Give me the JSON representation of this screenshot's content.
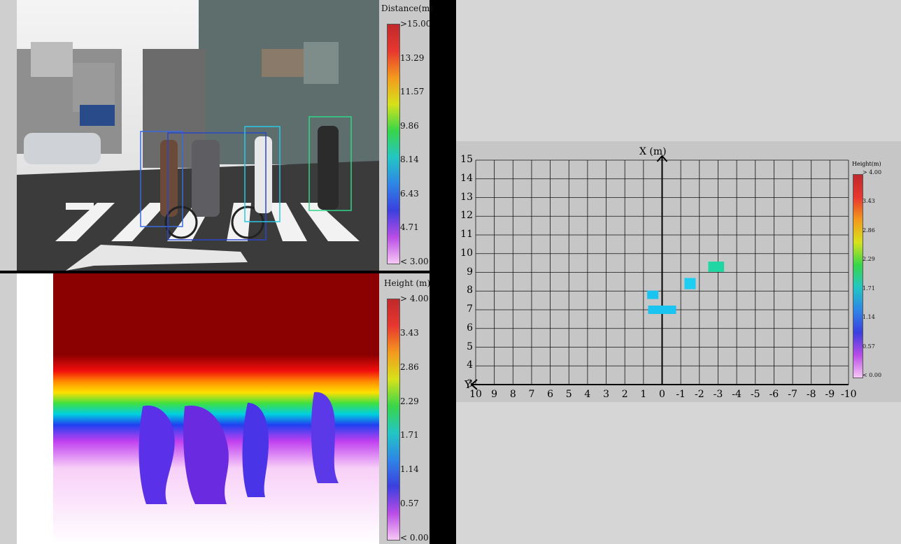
{
  "distance_colorbar": {
    "title": "Distance(m)",
    "ticks": [
      ">15.00",
      "13.29",
      "11.57",
      "9.86",
      "8.14",
      "6.43",
      "4.71",
      "< 3.00"
    ],
    "gradient": [
      "#c0292b",
      "#e8372f",
      "#f39a1d",
      "#d6e21a",
      "#38d64a",
      "#22c6c4",
      "#2e86e6",
      "#3b3fe0",
      "#b94ce6",
      "#f7c8f5"
    ]
  },
  "height_colorbar": {
    "title": "Height (m)",
    "ticks": [
      "> 4.00",
      "3.43",
      "2.86",
      "2.29",
      "1.71",
      "1.14",
      "0.57",
      "< 0.00"
    ],
    "gradient": [
      "#c0292b",
      "#e8372f",
      "#f39a1d",
      "#d6e21a",
      "#38d64a",
      "#22c6c4",
      "#2e86e6",
      "#3b3fe0",
      "#b94ce6",
      "#f7c8f5"
    ]
  },
  "bev": {
    "x_axis_label": "X (m)",
    "y_axis_label": "Y",
    "y_ticks": [
      "15",
      "14",
      "13",
      "12",
      "11",
      "10",
      "9",
      "8",
      "7",
      "6",
      "5",
      "4",
      "3"
    ],
    "x_ticks": [
      "10",
      "9",
      "8",
      "7",
      "6",
      "5",
      "4",
      "3",
      "2",
      "1",
      "0",
      "-1",
      "-2",
      "-3",
      "-4",
      "-5",
      "-6",
      "-7",
      "-8",
      "-9",
      "-10"
    ],
    "colorbar_title": "Height(m)",
    "colorbar_ticks": [
      "> 4.00",
      "3.43",
      "2.86",
      "2.29",
      "1.71",
      "1.14",
      "0.57",
      "< 0.00"
    ],
    "cells": [
      {
        "x": 0.5,
        "y": 7.8,
        "w": 0.6,
        "h": 0.45,
        "color": "#19c4f0"
      },
      {
        "x": 0.0,
        "y": 7.0,
        "w": 1.5,
        "h": 0.45,
        "color": "#19c4f0"
      },
      {
        "x": -1.5,
        "y": 8.4,
        "w": 0.6,
        "h": 0.6,
        "color": "#1ecdf2"
      },
      {
        "x": -2.9,
        "y": 9.3,
        "w": 0.85,
        "h": 0.55,
        "color": "#20d6a2"
      }
    ]
  },
  "detections": [
    {
      "x": 0.0,
      "y": 0.0,
      "w": 0.0,
      "h": 0.0,
      "color": "#3a6be0"
    }
  ]
}
